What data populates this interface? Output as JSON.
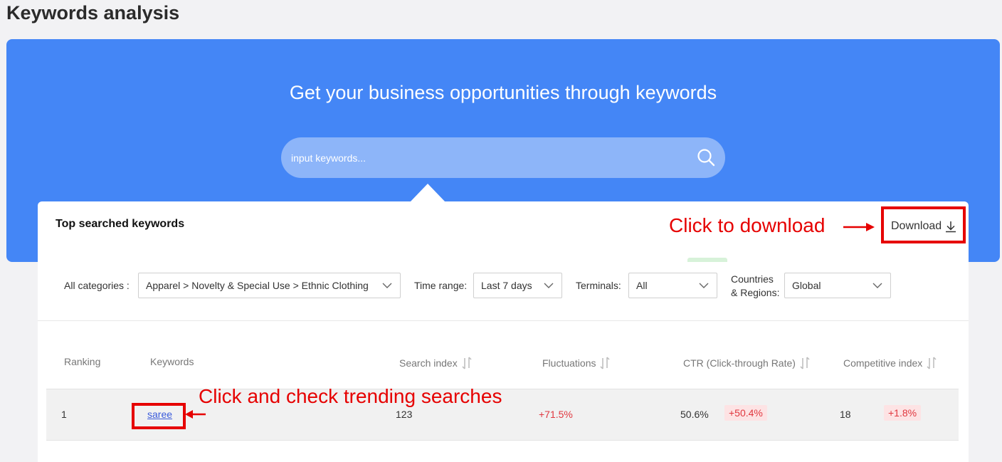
{
  "page": {
    "title": "Keywords analysis"
  },
  "hero": {
    "title": "Get your business opportunities through keywords",
    "search_placeholder": "input keywords..."
  },
  "card": {
    "title": "Top searched keywords",
    "download_label": "Download"
  },
  "annotations": {
    "download_hint": "Click to download",
    "keyword_hint": "Click and check trending searches"
  },
  "filters": {
    "categories_label": "All categories :",
    "categories_value": "Apparel > Novelty & Special Use > Ethnic Clothing",
    "time_range_label": "Time range:",
    "time_range_value": "Last 7 days",
    "terminals_label": "Terminals:",
    "terminals_value": "All",
    "countries_label_line1": "Countries",
    "countries_label_line2": "& Regions:",
    "countries_value": "Global"
  },
  "table": {
    "columns": [
      "Ranking",
      "Keywords",
      "Search index",
      "Fluctuations",
      "CTR (Click-through Rate)",
      "Competitive index"
    ],
    "rows": [
      {
        "ranking": "1",
        "keyword": "saree",
        "search_index": "123",
        "fluctuation": "+71.5%",
        "ctr": "50.6%",
        "ctr_change": "+50.4%",
        "competitive_index": "18",
        "competitive_change": "+1.8%"
      }
    ]
  },
  "colors": {
    "hero_blue": "#4486f6",
    "annotation_red": "#e60000",
    "positive_red": "#e0373f"
  }
}
